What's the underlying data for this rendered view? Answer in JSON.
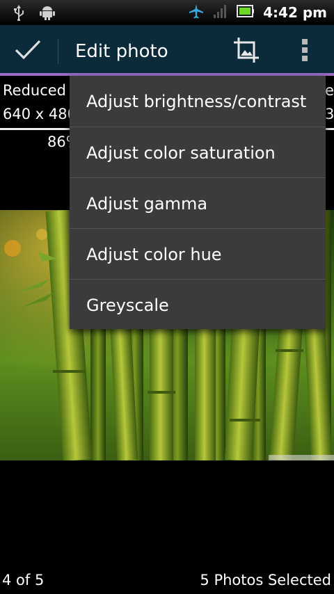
{
  "status_bar": {
    "time": "4:42 pm",
    "icons": [
      "usb-icon",
      "android-debug-icon",
      "airplane-mode-icon",
      "signal-icon",
      "battery-icon"
    ]
  },
  "action_bar": {
    "title": "Edit photo",
    "icons": [
      "checkmark-icon",
      "crop-icon",
      "overflow-menu-icon"
    ],
    "background": "#0b2a3a",
    "accent": "#9b6dc8"
  },
  "info": {
    "left_title": "Reduced",
    "left_size": "640 x 480",
    "left_percent": "86%",
    "right_title": "e",
    "right_size": "3"
  },
  "menu": {
    "items": [
      {
        "label": "Adjust brightness/contrast"
      },
      {
        "label": "Adjust color saturation"
      },
      {
        "label": "Adjust gamma"
      },
      {
        "label": "Adjust color hue"
      },
      {
        "label": "Greyscale"
      }
    ]
  },
  "footer": {
    "position": "4 of 5",
    "selected": "5 Photos Selected"
  }
}
